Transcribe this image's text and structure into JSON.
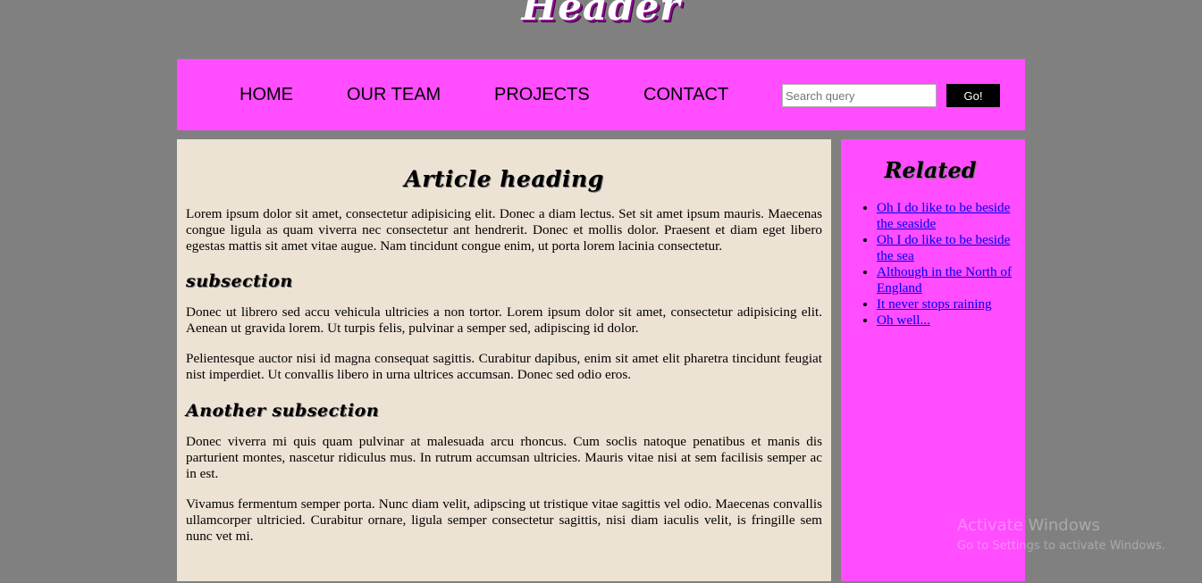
{
  "header": {
    "title": "Header"
  },
  "nav": {
    "items": [
      {
        "label": "HOME"
      },
      {
        "label": "OUR TEAM"
      },
      {
        "label": "PROJECTS"
      },
      {
        "label": "CONTACT"
      }
    ],
    "search": {
      "value": "",
      "placeholder": "Search query"
    },
    "go_label": "Go!"
  },
  "article": {
    "heading": "Article heading",
    "intro": "Lorem ipsum dolor sit amet, consectetur adipisicing elit. Donec a diam lectus. Set sit amet ipsum mauris. Maecenas congue ligula as quam viverra nec consectetur ant hendrerit. Donec et mollis dolor. Praesent et diam eget libero egestas mattis sit amet vitae augue. Nam tincidunt congue enim, ut porta lorem lacinia consectetur.",
    "subsection1": {
      "heading": "subsection",
      "paragraphs": [
        "Donec ut librero sed accu vehicula ultricies a non tortor. Lorem ipsum dolor sit amet, consectetur adipisicing elit. Aenean ut gravida lorem. Ut turpis felis, pulvinar a semper sed, adipiscing id dolor.",
        "Pelientesque auctor nisi id magna consequat sagittis. Curabitur dapibus, enim sit amet elit pharetra tincidunt feugiat nist imperdiet. Ut convallis libero in urna ultrices accumsan. Donec sed odio eros."
      ]
    },
    "subsection2": {
      "heading": "Another subsection",
      "paragraphs": [
        "Donec viverra mi quis quam pulvinar at malesuada arcu rhoncus. Cum soclis natoque penatibus et manis dis parturient montes, nascetur ridiculus mus. In rutrum accumsan ultricies. Mauris vitae nisi at sem facilisis semper ac in est.",
        "Vivamus fermentum semper porta. Nunc diam velit, adipscing ut tristique vitae sagittis vel odio. Maecenas convallis ullamcorper ultricied. Curabitur ornare, ligula semper consectetur sagittis, nisi diam iaculis velit, is fringille sem nunc vet mi."
      ]
    }
  },
  "sidebar": {
    "heading": "Related",
    "links": [
      {
        "label": "Oh I do like to be beside the seaside"
      },
      {
        "label": "Oh I do like to be beside the sea"
      },
      {
        "label": "Although in the North of England"
      },
      {
        "label": "It never stops raining"
      },
      {
        "label": "Oh well..."
      }
    ]
  },
  "watermark": {
    "title": "Activate Windows",
    "subtitle": "Go to Settings to activate Windows."
  },
  "colors": {
    "page_background": "#808080",
    "accent_pink": "#ff4dff",
    "article_background": "#ede3d4",
    "link": "#0000ee"
  }
}
